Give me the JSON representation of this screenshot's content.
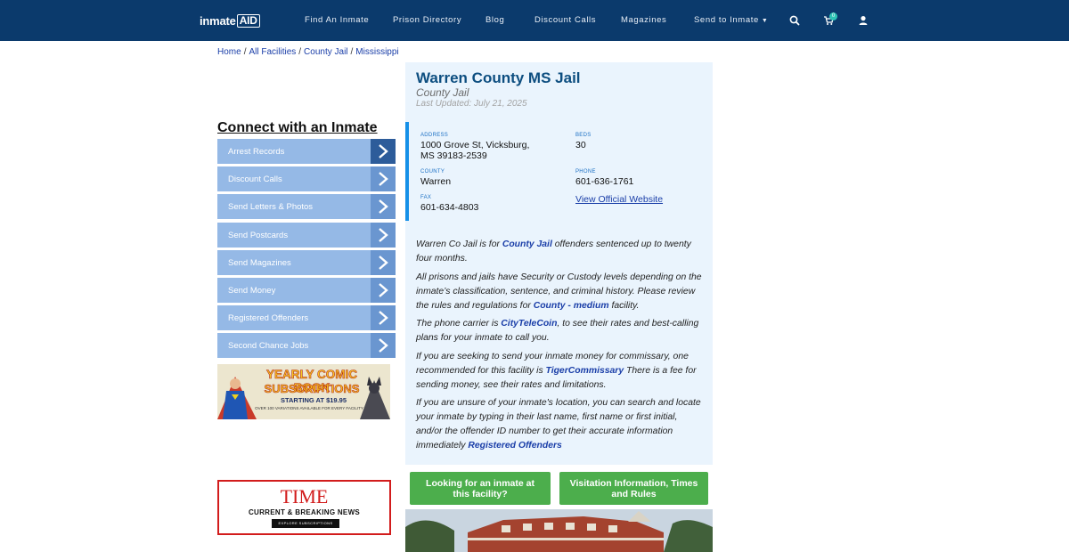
{
  "nav": {
    "logo_main": "inmate",
    "logo_box": "AID",
    "links": [
      "Find An Inmate",
      "Prison Directory",
      "Blog",
      "Discount Calls",
      "Magazines",
      "Send to Inmate"
    ],
    "cart_count": "0",
    "icons": [
      "search-icon",
      "cart-icon",
      "user-icon"
    ]
  },
  "breadcrumb": [
    "Home",
    "All Facilities",
    "County Jail",
    "Mississippi"
  ],
  "sidebar": {
    "title": "Connect with an Inmate",
    "items": [
      "Arrest Records",
      "Discount Calls",
      "Send Letters & Photos",
      "Send Postcards",
      "Send Magazines",
      "Send Money",
      "Registered Offenders",
      "Second Chance Jobs"
    ]
  },
  "comic_ad": {
    "line1": "YEARLY COMIC BOOK",
    "line2": "SUBSCRIPTIONS",
    "line3": "STARTING AT $19.95",
    "line4": "OVER 100 VARIATIONS AVAILABLE FOR EVERY FACILITY"
  },
  "time_ad": {
    "brand": "TIME",
    "tagline": "CURRENT & BREAKING NEWS",
    "button": "EXPLORE SUBSCRIPTIONS"
  },
  "facility": {
    "name": "Warren County MS Jail",
    "type": "County Jail",
    "updated": "Last Updated: July 21, 2025",
    "address_label": "ADDRESS",
    "address_line1": "1000 Grove St, Vicksburg,",
    "address_line2": "MS 39183-2539",
    "beds_label": "BEDS",
    "beds": "30",
    "county_label": "COUNTY",
    "county": "Warren",
    "phone_label": "PHONE",
    "phone": "601-636-1761",
    "fax_label": "FAX",
    "fax": "601-634-4803",
    "website_link": "View Official Website"
  },
  "description": {
    "p1_a": "Warren Co Jail is for ",
    "p1_link": "County Jail",
    "p1_b": " offenders sentenced up to twenty four months.",
    "p2_a": "All prisons and jails have Security or Custody levels depending on the inmate’s classification, sentence, and criminal history. Please review the rules and regulations for ",
    "p2_link": "County - medium",
    "p2_b": " facility.",
    "p3_a": "The phone carrier is ",
    "p3_link": "CityTeleCoin",
    "p3_b": ", to see their rates and best-calling plans for your inmate to call you.",
    "p4_a": "If you are seeking to send your inmate money for commissary, one recommended for this facility is ",
    "p4_link": "TigerCommissary",
    "p4_b": " There is a fee for sending money, see their rates and limitations.",
    "p5_a": "If you are unsure of your inmate's location, you can search and locate your inmate by typing in their last name, first name or first initial, and/or the offender ID number to get their accurate information immediately ",
    "p5_link": "Registered Offenders"
  },
  "buttons": {
    "lookup": "Looking for an inmate at this facility?",
    "visitation": "Visitation Information, Times and Rules"
  },
  "colors": {
    "nav_bg": "#0b3a6c",
    "card_bg": "#eaf4fd",
    "menu_item": "#95b9e6",
    "green": "#4cae4c",
    "link": "#1a3ea8"
  }
}
